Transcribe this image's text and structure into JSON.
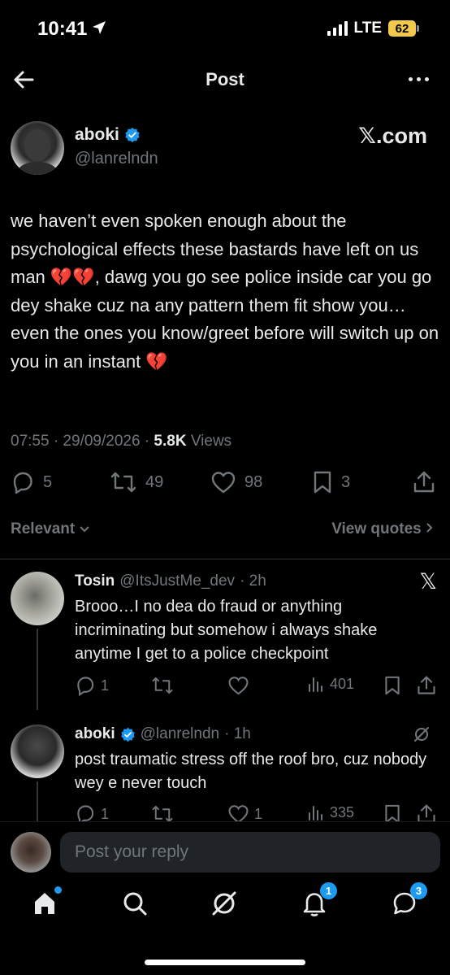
{
  "status_bar": {
    "time": "10:41",
    "network": "LTE",
    "battery": "62"
  },
  "header": {
    "title": "Post"
  },
  "post": {
    "author_name": "aboki",
    "author_handle": "@lanrelndn",
    "source": "𝕏.com",
    "text": "we haven’t even spoken enough about the psychological effects these bastards have left on us man 💔💔, dawg you go see police inside car you go dey shake cuz na any pattern them fit show you… even the ones you know/greet before will switch up on you in an instant 💔",
    "time": "07:55 · 29/09/2026 · ",
    "views_count": "5.8K",
    "views_label": " Views",
    "replies": "5",
    "reposts": "49",
    "likes": "98",
    "bookmarks": "3"
  },
  "filters": {
    "sort": "Relevant",
    "view_quotes": "View quotes"
  },
  "replies": [
    {
      "name": "Tosin",
      "handle": "@ItsJustMe_dev",
      "time": "· 2h",
      "source": "𝕏",
      "text": "Brooo…I no dea do fraud or anything incriminating but somehow i always shake anytime I get to a police checkpoint",
      "replies": "1",
      "reposts": "",
      "likes": "",
      "views": "401"
    },
    {
      "name": "aboki",
      "handle": "@lanrelndn",
      "time": "· 1h",
      "text": "post traumatic stress off the roof bro, cuz nobody wey e never touch",
      "replies": "1",
      "reposts": "",
      "likes": "1",
      "views": "335"
    }
  ],
  "reply_bar": {
    "placeholder": "Post your reply"
  },
  "tabbar": {
    "notifications_badge": "1",
    "messages_badge": "3"
  },
  "colors": {
    "accent": "#1d9bf0",
    "muted": "#71767b",
    "text": "#e7e9ea",
    "battery": "#f2c94c"
  }
}
